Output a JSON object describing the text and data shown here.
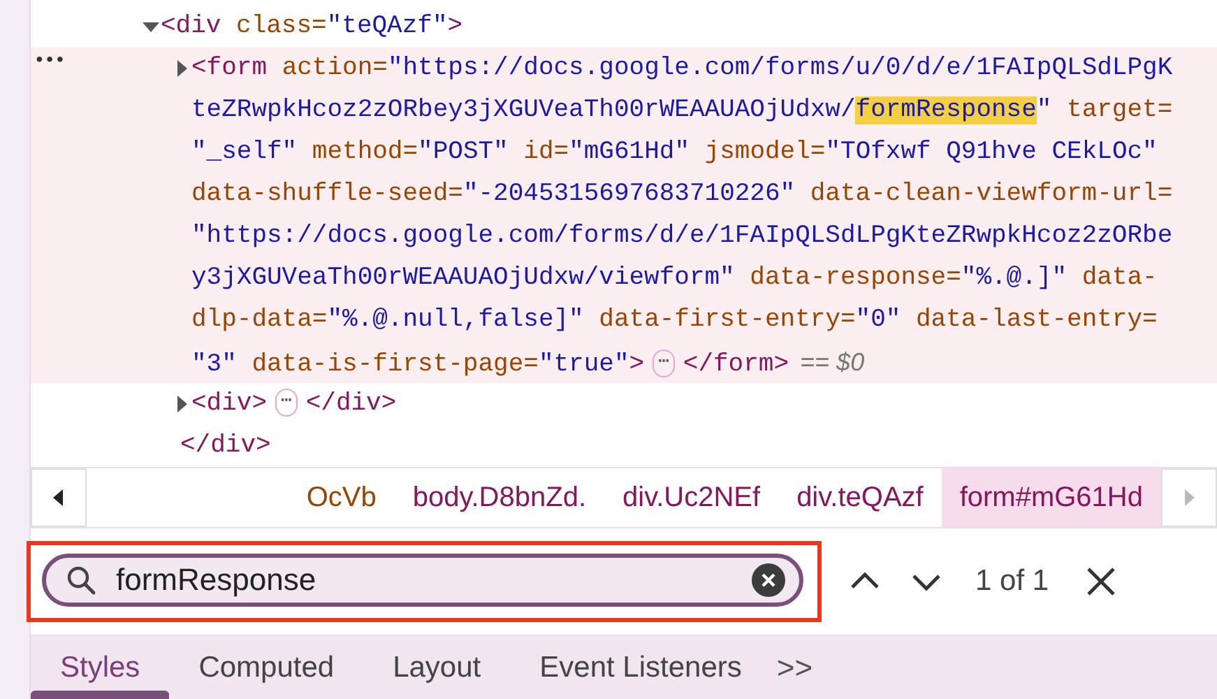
{
  "dom_tree": [
    {
      "expanded": true,
      "selected": false,
      "lines": [
        [
          {
            "kind": "tag",
            "text": "<div"
          },
          {
            "kind": "attr",
            "text": " class="
          },
          {
            "kind": "value",
            "text": "\"teQAzf\""
          },
          {
            "kind": "tag",
            "text": ">"
          }
        ]
      ],
      "children": [
        {
          "expanded": false,
          "selected": true,
          "row_menu": "•••",
          "lines": [
            [
              {
                "kind": "tag",
                "text": "<form"
              },
              {
                "kind": "attr",
                "text": " action="
              },
              {
                "kind": "value",
                "text": "\"https://docs.google.com/forms/u/0/d/e/1FAIpQLSdLPgK"
              }
            ],
            [
              {
                "kind": "value",
                "text": "teZRwpkHcoz2zORbey3jXGUVeaTh00rWEAAUAOjUdxw/"
              },
              {
                "kind": "match",
                "text": "formResponse"
              },
              {
                "kind": "value",
                "text": "\""
              },
              {
                "kind": "attr",
                "text": " target="
              }
            ],
            [
              {
                "kind": "value",
                "text": "\"_self\""
              },
              {
                "kind": "attr",
                "text": " method="
              },
              {
                "kind": "value",
                "text": "\"POST\""
              },
              {
                "kind": "attr",
                "text": " id="
              },
              {
                "kind": "value",
                "text": "\"mG61Hd\""
              },
              {
                "kind": "attr",
                "text": " jsmodel="
              },
              {
                "kind": "value",
                "text": "\"TOfxwf Q91hve CEkLOc\""
              }
            ],
            [
              {
                "kind": "attr",
                "text": "data-shuffle-seed="
              },
              {
                "kind": "value",
                "text": "\"-2045315697683710226\""
              },
              {
                "kind": "attr",
                "text": " data-clean-viewform-url="
              }
            ],
            [
              {
                "kind": "value",
                "text": "\"https://docs.google.com/forms/d/e/1FAIpQLSdLPgKteZRwpkHcoz2zORbe"
              }
            ],
            [
              {
                "kind": "value",
                "text": "y3jXGUVeaTh00rWEAAUAOjUdxw/viewform\""
              },
              {
                "kind": "attr",
                "text": " data-response="
              },
              {
                "kind": "value",
                "text": "\"%.@.]\""
              },
              {
                "kind": "attr",
                "text": " data-"
              }
            ],
            [
              {
                "kind": "attr",
                "text": "dlp-data="
              },
              {
                "kind": "value",
                "text": "\"%.@.null,false]\""
              },
              {
                "kind": "attr",
                "text": " data-first-entry="
              },
              {
                "kind": "value",
                "text": "\"0\""
              },
              {
                "kind": "attr",
                "text": " data-last-entry="
              }
            ],
            [
              {
                "kind": "value",
                "text": "\"3\""
              },
              {
                "kind": "attr",
                "text": " data-is-first-page="
              },
              {
                "kind": "value",
                "text": "\"true\""
              },
              {
                "kind": "tag",
                "text": ">"
              },
              {
                "kind": "badge",
                "text": "⋯"
              },
              {
                "kind": "tag",
                "text": "</form>"
              },
              {
                "kind": "comment",
                "text": "== $0"
              }
            ]
          ]
        },
        {
          "expanded": false,
          "selected": false,
          "lines": [
            [
              {
                "kind": "tag",
                "text": "<div>"
              },
              {
                "kind": "badge",
                "text": "⋯"
              },
              {
                "kind": "tag",
                "text": "</div>"
              }
            ]
          ]
        }
      ],
      "closing": [
        {
          "kind": "tag",
          "text": "</div>"
        }
      ]
    }
  ],
  "breadcrumbs": [
    {
      "text": "OcVb",
      "selected": false
    },
    {
      "text": "body.D8bnZd.",
      "selected": false
    },
    {
      "text": "div.Uc2NEf",
      "selected": false
    },
    {
      "text": "div.teQAzf",
      "selected": false
    },
    {
      "text": "form#mG61Hd",
      "selected": true
    }
  ],
  "search": {
    "value": "formResponse",
    "outlined": true,
    "match_count": "1 of 1"
  },
  "tabs": [
    {
      "label": "Styles",
      "selected": true
    },
    {
      "label": "Computed",
      "selected": false
    },
    {
      "label": "Layout",
      "selected": false
    },
    {
      "label": "Event Listeners",
      "selected": false
    }
  ],
  "tabs_overflow": ">>"
}
